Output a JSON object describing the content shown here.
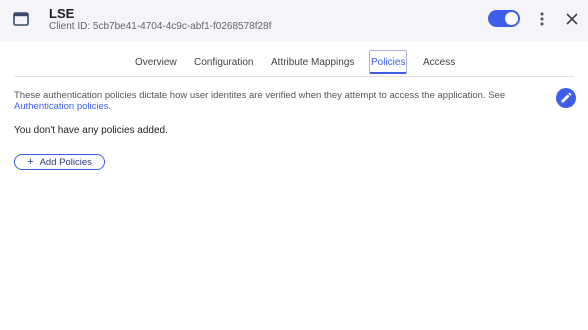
{
  "header": {
    "title": "LSE",
    "client_id": "Client ID: 5cb7be41-4704-4c9c-abf1-f0268578f28f",
    "enabled": true,
    "accent_color": "#3f5ee8"
  },
  "tabs": [
    {
      "label": "Overview",
      "active": false
    },
    {
      "label": "Configuration",
      "active": false
    },
    {
      "label": "Attribute Mappings",
      "active": false
    },
    {
      "label": "Policies",
      "active": true
    },
    {
      "label": "Access",
      "active": false
    }
  ],
  "policies": {
    "description": "These authentication policies dictate how user identites are verified when they attempt to access the application. See",
    "link_text": "Authentication policies.",
    "empty_message": "You don't have any policies added.",
    "add_button_label": "Add Policies"
  },
  "icons": {
    "app": "window-icon",
    "menu": "kebab-menu-icon",
    "close": "close-icon",
    "edit": "pencil-icon",
    "add": "plus-icon"
  }
}
